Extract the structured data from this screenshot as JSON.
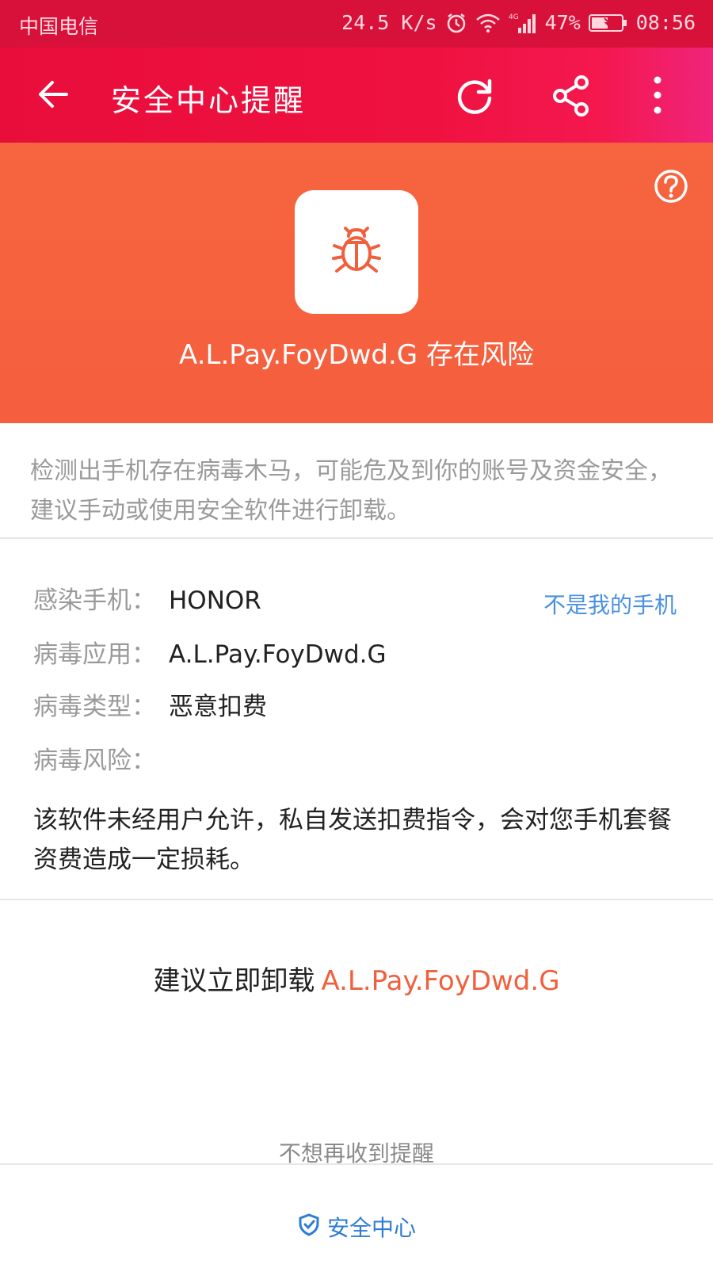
{
  "status_bar": {
    "carrier": "中国电信",
    "speed": "24.5 K/s",
    "battery": "47%",
    "time": "08:56"
  },
  "app_bar": {
    "title": "安全中心提醒"
  },
  "hero": {
    "text": "A.L.Pay.FoyDwd.G 存在风险"
  },
  "description": "检测出手机存在病毒木马，可能危及到你的账号及资金安全，建议手动或使用安全软件进行卸载。",
  "details": {
    "phone_label": "感染手机：",
    "phone_value": "HONOR",
    "not_my_phone": "不是我的手机",
    "app_label": "病毒应用：",
    "app_value": "A.L.Pay.FoyDwd.G",
    "type_label": "病毒类型：",
    "type_value": "恶意扣费",
    "risk_label": "病毒风险：",
    "risk_text": "该软件未经用户允许，私自发送扣费指令，会对您手机套餐资费造成一定损耗。"
  },
  "recommend": {
    "lead": "建议立即卸载",
    "app": "A.L.Pay.FoyDwd.G"
  },
  "no_remind": "不想再收到提醒",
  "footer": {
    "label": "安全中心"
  },
  "colors": {
    "status_bar": "#d8113a",
    "app_bar": "#ef1240",
    "hero": "#f6653f",
    "accent_orange": "#f0603d",
    "link_blue": "#4a90e2"
  },
  "icons": {
    "back": "arrow-left-icon",
    "refresh": "refresh-icon",
    "share": "share-icon",
    "more": "more-vertical-icon",
    "help": "help-circle-icon",
    "bug": "bug-icon",
    "shield": "shield-icon"
  }
}
